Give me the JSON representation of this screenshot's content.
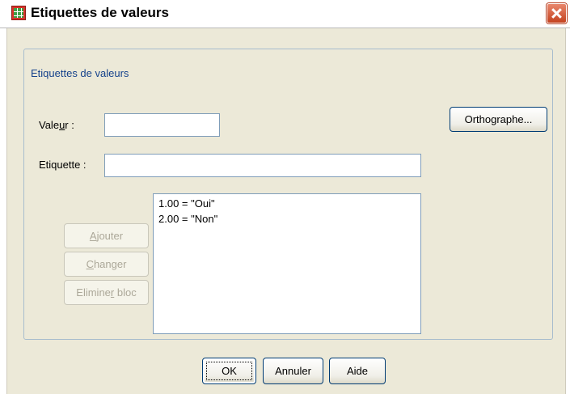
{
  "window": {
    "title": "Etiquettes de valeurs"
  },
  "group": {
    "legend": "Etiquettes de valeurs"
  },
  "value_field": {
    "label_pre": "Vale",
    "label_mnemonic": "u",
    "label_post": "r :",
    "value": ""
  },
  "label_field": {
    "label": "Etiquette :",
    "value": ""
  },
  "buttons": {
    "spelling": "Orthographe...",
    "add_mnemonic": "A",
    "add_rest": "jouter",
    "change_mnemonic": "C",
    "change_rest": "hanger",
    "remove_pre": "Elimine",
    "remove_mnemonic": "r",
    "remove_post": " bloc",
    "ok": "OK",
    "cancel": "Annuler",
    "help": "Aide"
  },
  "value_labels": [
    "1.00 = \"Oui\"",
    "2.00 = \"Non\""
  ],
  "colors": {
    "dialog_bg": "#ece9d8",
    "legend_text": "#15428b",
    "close_button": "#c4421f",
    "button_border": "#003c74"
  },
  "icons": {
    "app": "spss-grid-icon",
    "close": "close-icon"
  }
}
